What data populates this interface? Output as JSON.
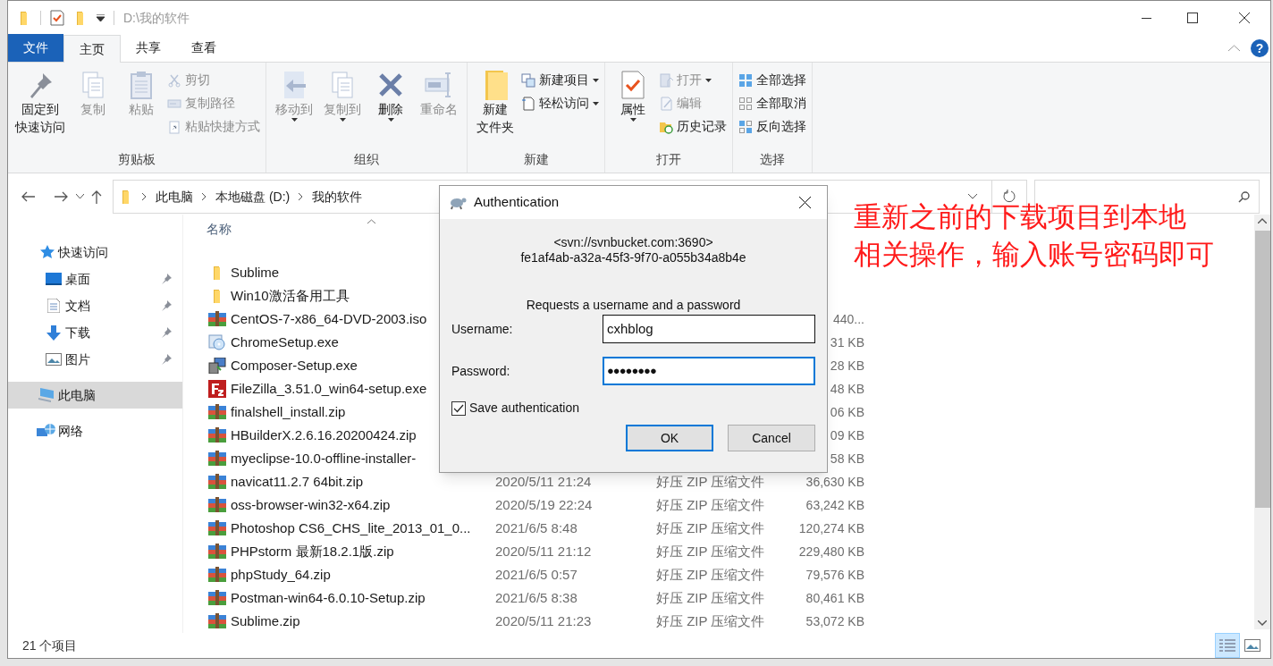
{
  "window": {
    "title": "D:\\我的软件"
  },
  "tabs": [
    {
      "label": "文件",
      "kind": "file",
      "selected": false
    },
    {
      "label": "主页",
      "kind": "tab",
      "selected": true
    },
    {
      "label": "共享",
      "kind": "tab",
      "selected": false
    },
    {
      "label": "查看",
      "kind": "tab",
      "selected": false
    }
  ],
  "help_button": "?",
  "ribbon": [
    {
      "title": "剪贴板",
      "items": [
        {
          "kind": "large",
          "lines": [
            "固定到",
            "快速访问"
          ],
          "disabled": false,
          "dropdown": false
        },
        {
          "kind": "large",
          "lines": [
            "复制"
          ],
          "disabled": true,
          "dropdown": false
        },
        {
          "kind": "large",
          "lines": [
            "粘贴"
          ],
          "disabled": true,
          "dropdown": false
        },
        {
          "kind": "stack",
          "items": [
            {
              "label": "剪切",
              "disabled": true,
              "dropdown": false
            },
            {
              "label": "复制路径",
              "disabled": true,
              "dropdown": false
            },
            {
              "label": "粘贴快捷方式",
              "disabled": true,
              "dropdown": false
            }
          ]
        }
      ]
    },
    {
      "title": "组织",
      "items": [
        {
          "kind": "large",
          "lines": [
            "移动到"
          ],
          "disabled": true,
          "dropdown": true
        },
        {
          "kind": "large",
          "lines": [
            "复制到"
          ],
          "disabled": true,
          "dropdown": true
        },
        {
          "kind": "large",
          "lines": [
            "删除"
          ],
          "disabled": false,
          "dropdown": true
        },
        {
          "kind": "large",
          "lines": [
            "重命名"
          ],
          "disabled": true,
          "dropdown": false
        }
      ]
    },
    {
      "title": "新建",
      "items": [
        {
          "kind": "large",
          "lines": [
            "新建",
            "文件夹"
          ],
          "disabled": false,
          "dropdown": false
        },
        {
          "kind": "stack",
          "items": [
            {
              "label": "新建项目",
              "disabled": false,
              "dropdown": true
            },
            {
              "label": "轻松访问",
              "disabled": false,
              "dropdown": true
            }
          ]
        }
      ]
    },
    {
      "title": "打开",
      "items": [
        {
          "kind": "large",
          "lines": [
            "属性"
          ],
          "disabled": false,
          "dropdown": true
        },
        {
          "kind": "stack",
          "items": [
            {
              "label": "打开",
              "disabled": true,
              "dropdown": true
            },
            {
              "label": "编辑",
              "disabled": true,
              "dropdown": false
            },
            {
              "label": "历史记录",
              "disabled": false,
              "dropdown": false
            }
          ]
        }
      ]
    },
    {
      "title": "选择",
      "items": [
        {
          "kind": "stack",
          "items": [
            {
              "label": "全部选择",
              "disabled": false,
              "dropdown": false
            },
            {
              "label": "全部取消",
              "disabled": false,
              "dropdown": false
            },
            {
              "label": "反向选择",
              "disabled": false,
              "dropdown": false
            }
          ]
        }
      ]
    }
  ],
  "breadcrumbs": [
    "此电脑",
    "本地磁盘 (D:)",
    "我的软件"
  ],
  "nav": [
    {
      "label": "快速访问",
      "pinned": false,
      "selected": false,
      "children": [
        {
          "label": "桌面",
          "pinned": true,
          "selected": false
        },
        {
          "label": "文档",
          "pinned": true,
          "selected": false
        },
        {
          "label": "下载",
          "pinned": true,
          "selected": false
        },
        {
          "label": "图片",
          "pinned": true,
          "selected": false
        }
      ]
    },
    {
      "label": "此电脑",
      "pinned": false,
      "selected": true
    },
    {
      "label": "网络",
      "pinned": false,
      "selected": false
    }
  ],
  "column_header": "名称",
  "files": [
    {
      "kind": "folder",
      "name": "Sublime"
    },
    {
      "kind": "folder",
      "name": "Win10激活备用工具"
    },
    {
      "kind": "archive",
      "name": "CentOS-7-x86_64-DVD-2003.iso",
      "size": "440..."
    },
    {
      "kind": "disc",
      "name": "ChromeSetup.exe",
      "size": "31 KB"
    },
    {
      "kind": "installer",
      "name": "Composer-Setup.exe",
      "size": "28 KB"
    },
    {
      "kind": "filezilla",
      "name": "FileZilla_3.51.0_win64-setup.exe",
      "size": "48 KB"
    },
    {
      "kind": "archive",
      "name": "finalshell_install.zip",
      "size": "06 KB"
    },
    {
      "kind": "archive",
      "name": "HBuilderX.2.6.16.20200424.zip",
      "size": "09 KB"
    },
    {
      "kind": "archive",
      "name": "myeclipse-10.0-offline-installer-",
      "size": "58 KB"
    },
    {
      "kind": "archive",
      "name": "navicat11.2.7 64bit.zip",
      "date": "2020/5/11 21:24",
      "type": "好压 ZIP 压缩文件",
      "size": "36,630 KB"
    },
    {
      "kind": "archive",
      "name": "oss-browser-win32-x64.zip",
      "date": "2020/5/19 22:24",
      "type": "好压 ZIP 压缩文件",
      "size": "63,242 KB"
    },
    {
      "kind": "archive",
      "name": "Photoshop CS6_CHS_lite_2013_01_0...",
      "date": "2021/6/5 8:48",
      "type": "好压 ZIP 压缩文件",
      "size": "120,274 KB"
    },
    {
      "kind": "archive",
      "name": "PHPstorm  最新18.2.1版.zip",
      "date": "2020/5/11 21:12",
      "type": "好压 ZIP 压缩文件",
      "size": "229,480 KB"
    },
    {
      "kind": "archive",
      "name": "phpStudy_64.zip",
      "date": "2021/6/5 0:57",
      "type": "好压 ZIP 压缩文件",
      "size": "79,576 KB"
    },
    {
      "kind": "archive",
      "name": "Postman-win64-6.0.10-Setup.zip",
      "date": "2021/6/5 8:38",
      "type": "好压 ZIP 压缩文件",
      "size": "80,461 KB"
    },
    {
      "kind": "archive",
      "name": "Sublime.zip",
      "date": "2020/5/11 21:23",
      "type": "好压 ZIP 压缩文件",
      "size": "53,072 KB"
    }
  ],
  "status_bar": {
    "count": "21 个项目",
    "views": [
      {
        "kind": "details",
        "selected": true
      },
      {
        "kind": "thumbnails",
        "selected": false
      }
    ]
  },
  "dialog": {
    "title": "Authentication",
    "url": "<svn://svnbucket.com:3690>",
    "uuid": "fe1af4ab-a32a-45f3-9f70-a055b34a8b4e",
    "prompt": "Requests a username and a password",
    "username_label": "Username:",
    "username": "cxhblog",
    "password_label": "Password:",
    "password": "●●●●●●●●",
    "save": {
      "label": "Save authentication",
      "checked": true
    },
    "buttons": [
      {
        "label": "OK",
        "default": true
      },
      {
        "label": "Cancel",
        "default": false
      }
    ]
  },
  "annotation": [
    "重新之前的下载项目到本地",
    "相关操作，输入账号密码即可"
  ]
}
